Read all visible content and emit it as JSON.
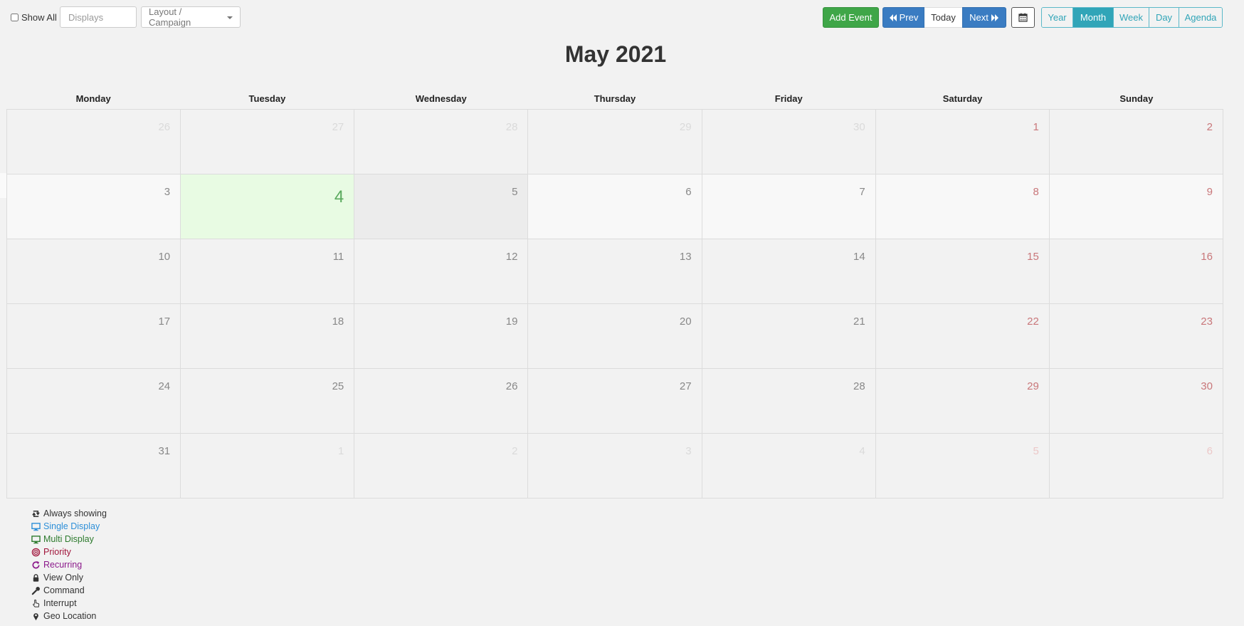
{
  "toolbar": {
    "show_all_label": "Show All",
    "displays_placeholder": "Displays",
    "layout_campaign_label": "Layout / Campaign",
    "add_event_label": "Add Event",
    "prev_label": "Prev",
    "today_label": "Today",
    "next_label": "Next",
    "view_buttons": [
      "Year",
      "Month",
      "Week",
      "Day",
      "Agenda"
    ],
    "active_view": "Month"
  },
  "calendar": {
    "title": "May 2021",
    "weekdays": [
      "Monday",
      "Tuesday",
      "Wednesday",
      "Thursday",
      "Friday",
      "Saturday",
      "Sunday"
    ],
    "weeks": [
      [
        "26",
        "27",
        "28",
        "29",
        "30",
        "1",
        "2"
      ],
      [
        "3",
        "4",
        "5",
        "6",
        "7",
        "8",
        "9"
      ],
      [
        "10",
        "11",
        "12",
        "13",
        "14",
        "15",
        "16"
      ],
      [
        "17",
        "18",
        "19",
        "20",
        "21",
        "22",
        "23"
      ],
      [
        "24",
        "25",
        "26",
        "27",
        "28",
        "29",
        "30"
      ],
      [
        "31",
        "1",
        "2",
        "3",
        "4",
        "5",
        "6"
      ]
    ],
    "today": "4"
  },
  "legend": {
    "always_showing": "Always showing",
    "single_display": "Single Display",
    "multi_display": "Multi Display",
    "priority": "Priority",
    "recurring": "Recurring",
    "view_only": "View Only",
    "command": "Command",
    "interrupt": "Interrupt",
    "geo_location": "Geo Location"
  },
  "colors": {
    "add_event": "#3fa648",
    "nav_primary": "#3a7cc2",
    "view_accent": "#31a5b8",
    "today_cell": "#e8fbe3",
    "weekend_number": "#c9777a",
    "single_display": "#2d8fd8",
    "multi_display": "#2d7a2d",
    "priority": "#a0143a",
    "recurring": "#8b1a8b"
  }
}
